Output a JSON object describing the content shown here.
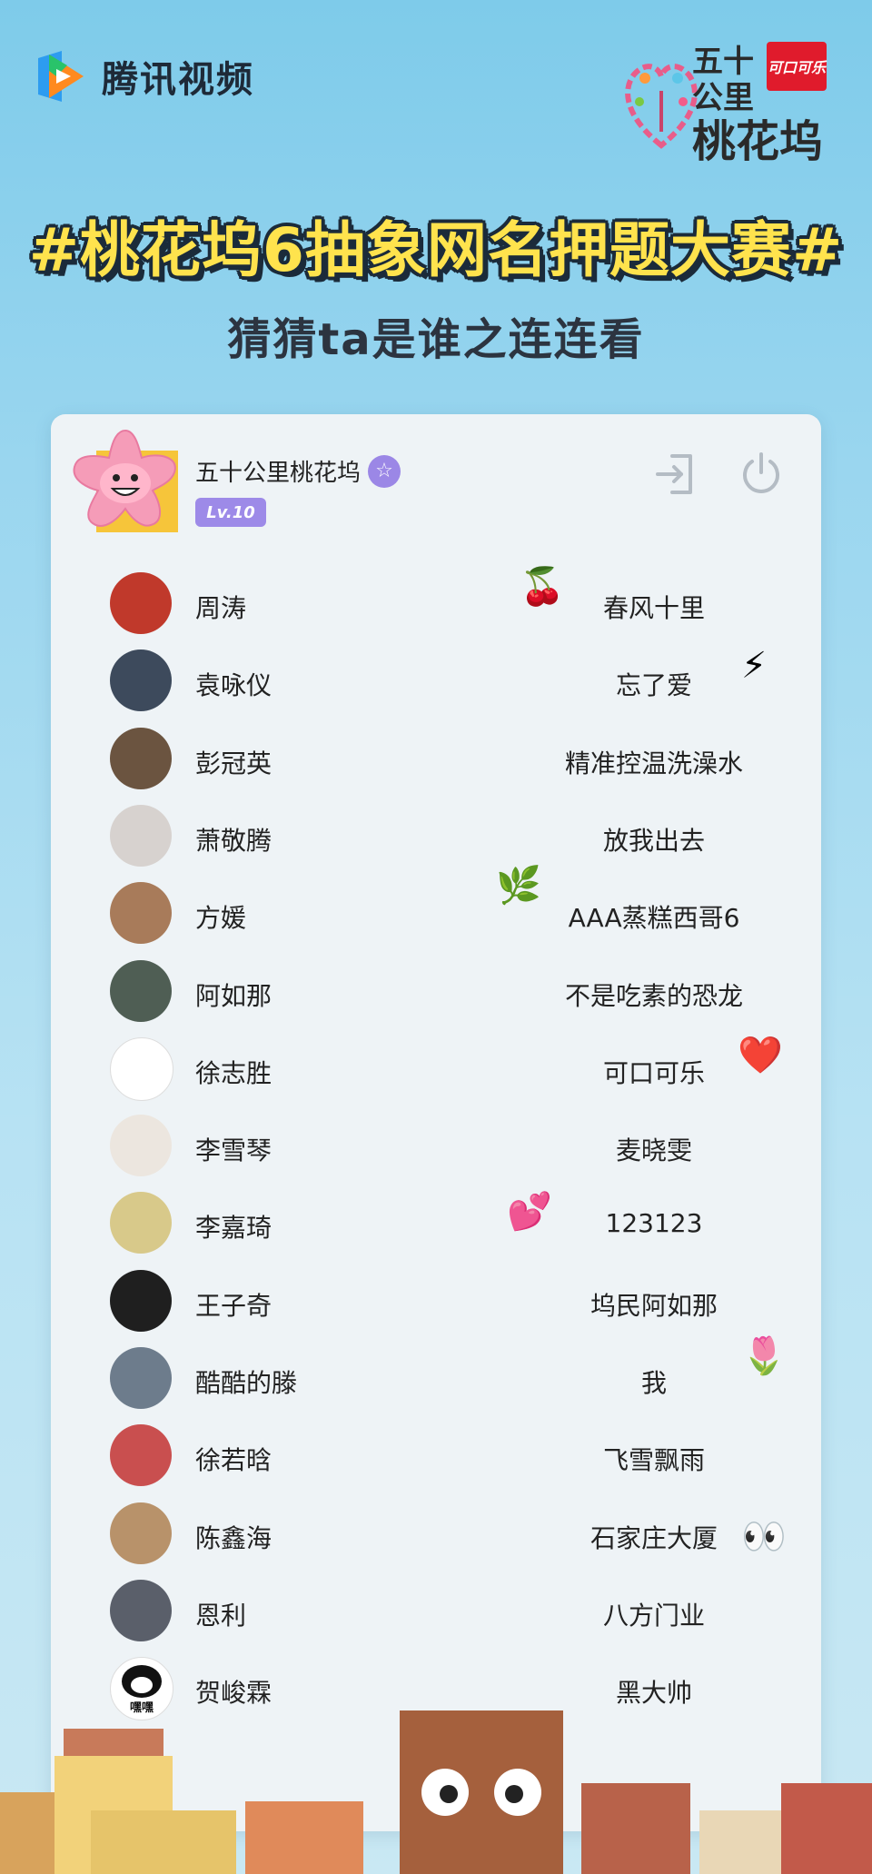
{
  "brand": {
    "name": "腾讯视频"
  },
  "partner": {
    "line1": "五十",
    "line2": "公里",
    "line3": "桃花坞",
    "sponsor": "可口可乐",
    "tag": "桃花坞"
  },
  "headline": "#桃花坞6抽象网名押题大赛#",
  "subhead": "猜猜ta是谁之连连看",
  "profile": {
    "name": "五十公里桃花坞",
    "level": "Lv.10"
  },
  "colors": {
    "accent": "#9d8ae8",
    "headline": "#ffe34d",
    "coke": "#e01b2c"
  },
  "rows": [
    {
      "name": "周涛",
      "alias": "春风十里",
      "emoji": "🍒",
      "emoji_name": "cherry-icon",
      "avatar_color": "#c0392b"
    },
    {
      "name": "袁咏仪",
      "alias": "忘了爱",
      "emoji": "⚡",
      "emoji_name": "lightning-icon",
      "avatar_color": "#3d4a5c"
    },
    {
      "name": "彭冠英",
      "alias": "精准控温洗澡水",
      "emoji": "",
      "emoji_name": "",
      "avatar_color": "#6b5440"
    },
    {
      "name": "萧敬腾",
      "alias": "放我出去",
      "emoji": "",
      "emoji_name": "",
      "avatar_color": "#d7d2cf"
    },
    {
      "name": "方媛",
      "alias": "AAA蒸糕西哥6",
      "emoji": "🌿",
      "emoji_name": "herb-icon",
      "avatar_color": "#a87b5a"
    },
    {
      "name": "阿如那",
      "alias": "不是吃素的恐龙",
      "emoji": "",
      "emoji_name": "",
      "avatar_color": "#4f5e54"
    },
    {
      "name": "徐志胜",
      "alias": "可口可乐",
      "emoji": "❤️",
      "emoji_name": "heart-icon",
      "avatar_color": "#ffffff"
    },
    {
      "name": "李雪琴",
      "alias": "麦晓雯",
      "emoji": "",
      "emoji_name": "",
      "avatar_color": "#ece6df"
    },
    {
      "name": "李嘉琦",
      "alias": "123123",
      "emoji": "💕",
      "emoji_name": "two-hearts-icon",
      "avatar_color": "#d8c98a"
    },
    {
      "name": "王子奇",
      "alias": "坞民阿如那",
      "emoji": "",
      "emoji_name": "",
      "avatar_color": "#1f1f1f"
    },
    {
      "name": "酷酷的滕",
      "alias": "我",
      "emoji": "🌷",
      "emoji_name": "tulip-icon",
      "avatar_color": "#6d7c8c"
    },
    {
      "name": "徐若晗",
      "alias": "飞雪飘雨",
      "emoji": "",
      "emoji_name": "",
      "avatar_color": "#c94f4f"
    },
    {
      "name": "陈鑫海",
      "alias": "石家庄大厦",
      "emoji": "👀",
      "emoji_name": "eyes-icon",
      "avatar_color": "#b8926a"
    },
    {
      "name": "恩利",
      "alias": "八方门业",
      "emoji": "",
      "emoji_name": "",
      "avatar_color": "#5a5f6a"
    },
    {
      "name": "贺峻霖",
      "alias": "黑大帅",
      "emoji": "",
      "emoji_name": "",
      "avatar_color": "#ffffff",
      "avatar_caption": "嘿嘿"
    }
  ]
}
